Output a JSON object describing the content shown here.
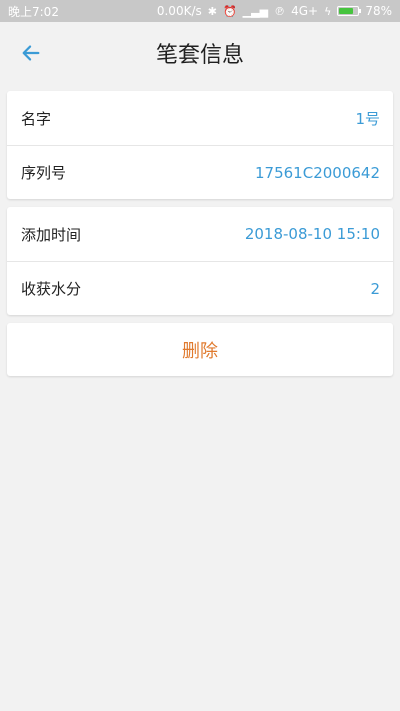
{
  "status_bar": {
    "time": "晚上7:02",
    "speed": "0.00K/s",
    "network": "4G+",
    "sim_label": "℗",
    "battery": "78%",
    "battery_level": 0.78
  },
  "header": {
    "title": "笔套信息",
    "back_icon": "arrow-left-icon"
  },
  "card_one": {
    "rows": [
      {
        "label": "名字",
        "value": "1号"
      },
      {
        "label": "序列号",
        "value": "17561C2000642"
      }
    ]
  },
  "card_two": {
    "rows": [
      {
        "label": "添加时间",
        "value": "2018-08-10 15:10"
      },
      {
        "label": "收获水分",
        "value": "2"
      }
    ]
  },
  "actions": {
    "delete_label": "删除"
  },
  "colors": {
    "accent": "#3b9bd6",
    "danger": "#e07a2e",
    "background": "#f2f2f2",
    "status_bar": "#c8c8c8"
  }
}
